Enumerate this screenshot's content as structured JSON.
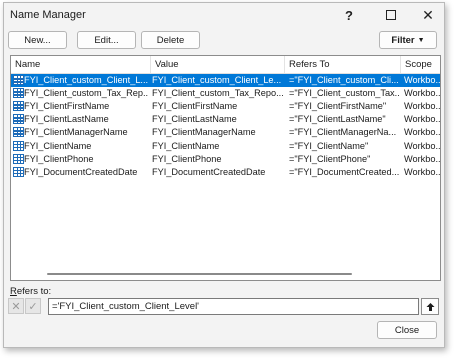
{
  "window": {
    "title": "Name Manager"
  },
  "toolbar": {
    "new_label": "New...",
    "edit_label": "Edit...",
    "delete_label": "Delete",
    "filter_label": "Filter"
  },
  "table": {
    "columns": [
      "Name",
      "Value",
      "Refers To",
      "Scope"
    ],
    "rows": [
      {
        "name": "FYI_Client_custom_Client_L...",
        "value": "FYI_Client_custom_Client_Le...",
        "refers": "=\"FYI_Client_custom_Cli...",
        "scope": "Workbo..."
      },
      {
        "name": "FYI_Client_custom_Tax_Rep...",
        "value": "FYI_Client_custom_Tax_Repo...",
        "refers": "=\"FYI_Client_custom_Tax...",
        "scope": "Workbo..."
      },
      {
        "name": "FYI_ClientFirstName",
        "value": "FYI_ClientFirstName",
        "refers": "=\"FYI_ClientFirstName\"",
        "scope": "Workbo..."
      },
      {
        "name": "FYI_ClientLastName",
        "value": "FYI_ClientLastName",
        "refers": "=\"FYI_ClientLastName\"",
        "scope": "Workbo..."
      },
      {
        "name": "FYI_ClientManagerName",
        "value": "FYI_ClientManagerName",
        "refers": "=\"FYI_ClientManagerNa...",
        "scope": "Workbo..."
      },
      {
        "name": "FYI_ClientName",
        "value": "FYI_ClientName",
        "refers": "=\"FYI_ClientName\"",
        "scope": "Workbo..."
      },
      {
        "name": "FYI_ClientPhone",
        "value": "FYI_ClientPhone",
        "refers": "=\"FYI_ClientPhone\"",
        "scope": "Workbo..."
      },
      {
        "name": "FYI_DocumentCreatedDate",
        "value": "FYI_DocumentCreatedDate",
        "refers": "=\"FYI_DocumentCreated...",
        "scope": "Workbo..."
      }
    ],
    "selected_index": 0
  },
  "refers_to": {
    "label": "Refers to:",
    "value": "='FYI_Client_custom_Client_Level'"
  },
  "footer": {
    "close_label": "Close"
  },
  "colors": {
    "selection": "#0078d7",
    "icon_blue": "#1e6bb8"
  }
}
